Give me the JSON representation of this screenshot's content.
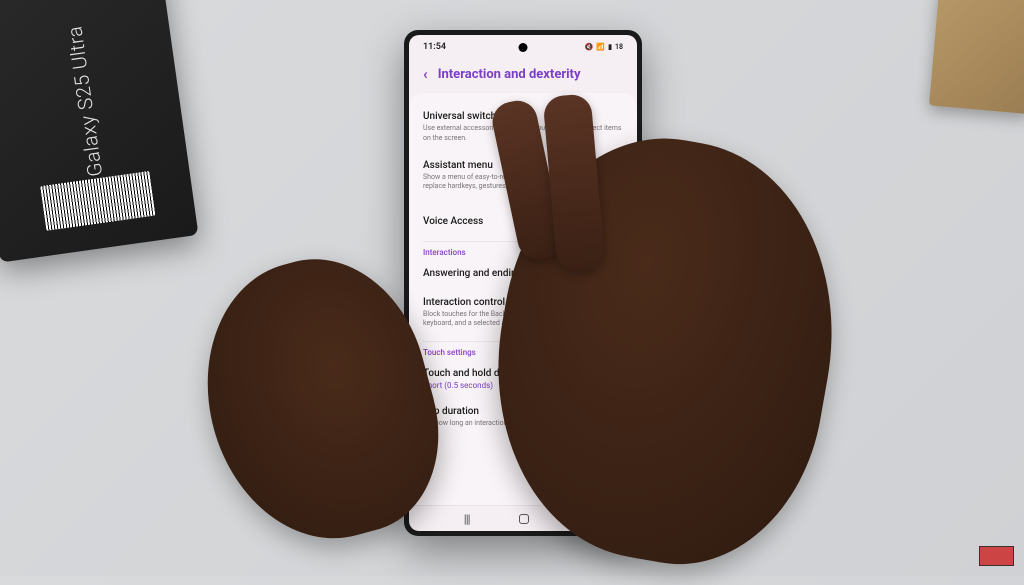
{
  "environment": {
    "product_box_label": "Galaxy S25 Ultra"
  },
  "status_bar": {
    "time": "11:54",
    "battery": "18"
  },
  "header": {
    "title": "Interaction and dexterity"
  },
  "settings": {
    "universal_switch": {
      "title": "Universal switch",
      "desc": "Use external accessories to control your phone and select items on the screen."
    },
    "assistant_menu": {
      "title": "Assistant menu",
      "desc": "Show a menu of easy-to-reach buttons that let you replace hardkeys, gestures, and other interactions.",
      "toggle_on": true
    },
    "voice_access": {
      "title": "Voice Access"
    },
    "section_interactions": "Interactions",
    "answering_calls": {
      "title": "Answering and ending calls"
    },
    "interaction_control": {
      "title": "Interaction control",
      "desc": "Block touches for the Back, Home, and Recents buttons, the keyboard, and a selected area of the screen."
    },
    "section_touch": "Touch settings",
    "touch_hold_delay": {
      "title": "Touch and hold delay",
      "value": "Short (0.5 seconds)"
    },
    "tap_duration": {
      "title": "Tap duration",
      "desc": "Set how long an interaction needs to be held to"
    }
  }
}
